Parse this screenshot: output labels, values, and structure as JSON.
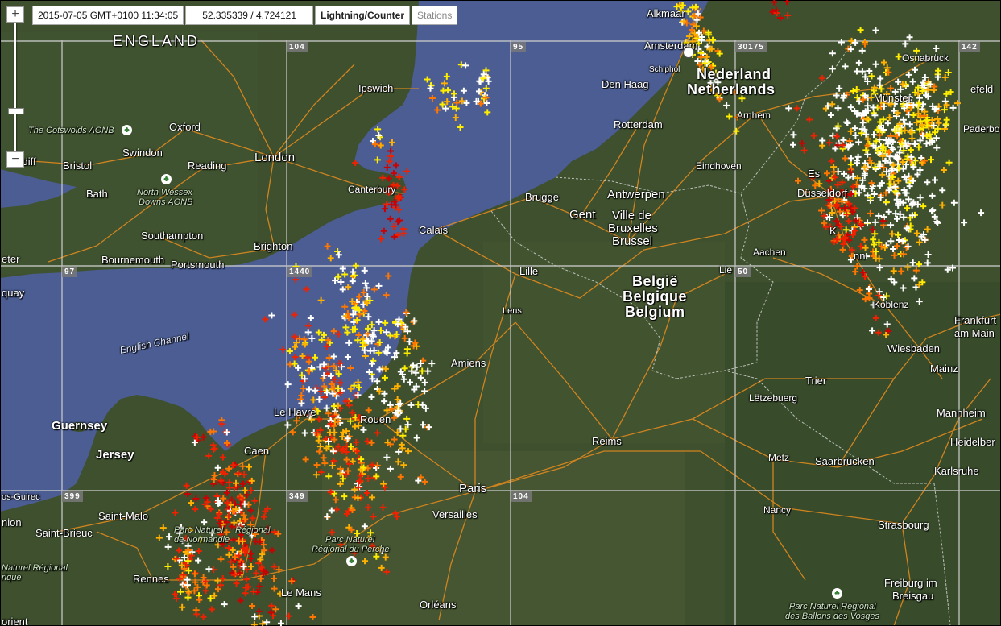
{
  "toolbar": {
    "datetime": "2015-07-05 GMT+0100 11:34:05",
    "coords": "52.335339 / 4.724121",
    "mode_label": "Lightning/Counter",
    "stations_label": "Stations"
  },
  "zoom": {
    "in_label": "+",
    "out_label": "−",
    "mid_label": "−"
  },
  "colors": {
    "sea": "#4a5c8f",
    "land": "#3d4f2d",
    "roads": "#e08a1e",
    "grid": "#cccccc",
    "strike_new": "#ffffff",
    "strike_1": "#ffee00",
    "strike_2": "#ffb000",
    "strike_3": "#ff7700",
    "strike_4": "#ee2200",
    "strike_old": "#cc0000"
  },
  "grid_cells": [
    "104",
    "95",
    "30175",
    "142",
    "97",
    "1440",
    "50",
    "399",
    "349",
    "104"
  ],
  "countries": {
    "england": "ENGLAND",
    "nl1": "Nederland",
    "nl2": "Netherlands",
    "be1": "België",
    "be2": "Belgique",
    "be3": "Belgium"
  },
  "water": {
    "channel": "English Channel"
  },
  "parks": {
    "cotswolds": "The Cotswolds AONB",
    "wessex1": "North Wessex",
    "wessex2": "Downs AONB",
    "normandie1": "Parc Naturel",
    "normandie2": "Régional",
    "normandie3": "de Normandie",
    "perche1": "Parc Naturel",
    "perche2": "Régional du Perche",
    "bretagne1": "Naturel Régional",
    "bretagne2": "rique",
    "vosges1": "Parc Naturel Régional",
    "vosges2": "des Ballons des Vosges"
  },
  "cities": {
    "oxford": "Oxford",
    "swindon": "Swindon",
    "bristol": "Bristol",
    "cardiff": "ardiff",
    "bath": "Bath",
    "reading": "Reading",
    "london": "London",
    "southampton": "Southampton",
    "brighton": "Brighton",
    "bournemouth": "Bournemouth",
    "portsmouth": "Portsmouth",
    "exeter": "eter",
    "torquay": "quay",
    "ipswich": "Ipswich",
    "canterbury": "Canterbury",
    "calais": "Calais",
    "alkmaar": "Alkmaar",
    "amsterdam": "Amsterdam",
    "schiphol": "Schiphol",
    "denhaag": "Den Haag",
    "rotterdam": "Rotterdam",
    "arnhem": "Arnhem",
    "eindhoven": "Eindhoven",
    "osnabruck": "Osnabrück",
    "bielefeld": "efeld",
    "munster": "Münster",
    "paderborn": "Paderbo",
    "essen": "Es",
    "dusseldorf": "Düsseldorf",
    "koln": "K",
    "bonn": "nn",
    "aachen": "Aachen",
    "liege": "Lie",
    "bruges": "Brugge",
    "gent": "Gent",
    "antwerpen": "Antwerpen",
    "brux1": "Ville de",
    "brux2": "Bruxelles",
    "brux3": "Brussel",
    "lille": "Lille",
    "lens": "Lens",
    "koblenz": "Koblenz",
    "frankfurt1": "Frankfurt",
    "frankfurt2": "am Main",
    "wiesbaden": "Wiesbaden",
    "mainz": "Mainz",
    "trier": "Trier",
    "letzebuerg": "Lëtzebuerg",
    "mannheim": "Mannheim",
    "heidelberg": "Heidelber",
    "karlsruhe": "Karlsruhe",
    "saarbrucken": "Saarbrücken",
    "metz": "Metz",
    "nancy": "Nancy",
    "strasbourg": "Strasbourg",
    "freiburg1": "Freiburg im",
    "freiburg2": "Breisgau",
    "amiens": "Amiens",
    "reims": "Reims",
    "paris": "Paris",
    "versailles": "Versailles",
    "orleans": "Orléans",
    "lemans": "Le Mans",
    "rennes": "Rennes",
    "lehavre": "Le Havre",
    "rouen": "Rouen",
    "caen": "Caen",
    "guernsey": "Guernsey",
    "jersey": "Jersey",
    "stmalo": "Saint-Malo",
    "stbrieuc": "Saint-Brieuc",
    "perrosguirec": "os-Guirec",
    "lannion": "nion",
    "lorient": "orient"
  }
}
